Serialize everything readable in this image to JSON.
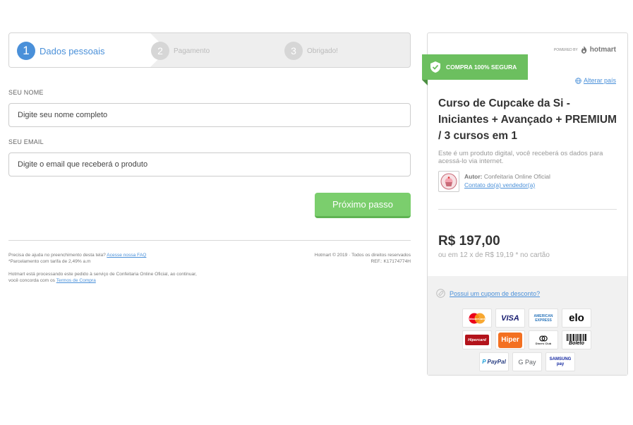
{
  "steps": [
    {
      "num": "1",
      "label": "Dados pessoais"
    },
    {
      "num": "2",
      "label": "Pagamento"
    },
    {
      "num": "3",
      "label": "Obrigado!"
    }
  ],
  "form": {
    "name_label": "SEU NOME",
    "name_placeholder": "Digite seu nome completo",
    "email_label": "SEU EMAIL",
    "email_placeholder": "Digite o email que receberá o produto",
    "next_button": "Próximo passo"
  },
  "footer": {
    "help_text": "Precisa de ajuda no preenchimento desta tela?",
    "help_link": "Acesse nossa FAQ",
    "installment_note": "*Parcelamento com tarifa de 2,49% a.m",
    "processing_text": "Hotmart está processando este pedido à serviço de Confeitaria Online Oficial, ao continuar, você concorda com os",
    "terms_link": "Termos de Compra",
    "copyright": "Hotmart © 2019 · Todos os direitos reservados",
    "ref": "REF.: K17174774H"
  },
  "panel": {
    "powered_by": "POWERED BY",
    "brand": "hotmart",
    "secure_badge": "COMPRA 100% SEGURA",
    "change_country": "Alterar país",
    "product_title": "Curso de Cupcake da Si - Iniciantes + Avançado + PREMIUM / 3 cursos em 1",
    "product_desc": "Este é um produto digital, você receberá os dados para acessá-lo via internet.",
    "author_label": "Autor:",
    "author_name": "Confeitaria Online Oficial",
    "contact_seller": "Contato do(a) vendedor(a)",
    "price": "R$ 197,00",
    "installments": "ou em 12 x de R$ 19,19 * no cartão",
    "coupon": "Possui um cupom de desconto?"
  },
  "payment_methods": [
    [
      "MasterCard",
      "VISA",
      "AMERICAN EXPRESS",
      "elo"
    ],
    [
      "Hipercard",
      "Hiper",
      "Diners Club",
      "Boleto"
    ],
    [
      "PayPal",
      "G Pay",
      "SAMSUNG pay"
    ]
  ],
  "colors": {
    "accent_blue": "#4a90d9",
    "green": "#7bce6d",
    "secure_green": "#6cbf5f"
  }
}
